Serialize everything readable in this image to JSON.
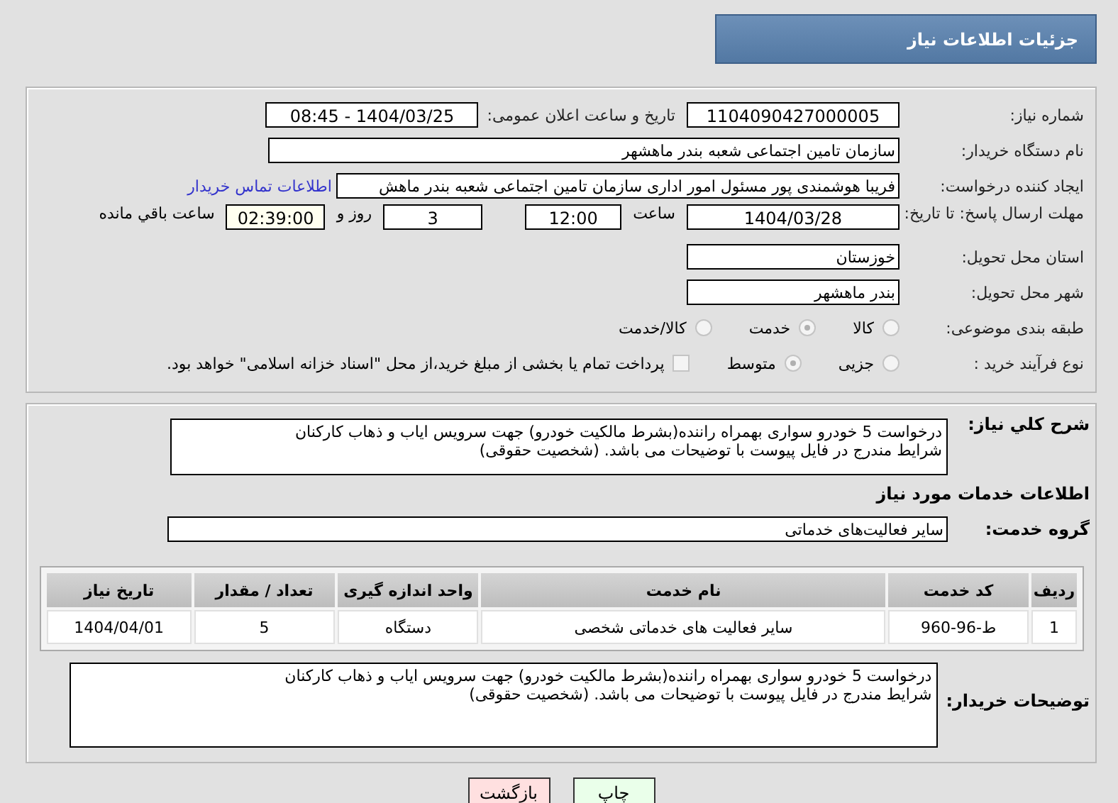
{
  "header": {
    "title": "جزئیات اطلاعات نیاز"
  },
  "need_number": {
    "label": "شماره نیاز:",
    "value": "1104090427000005"
  },
  "announce": {
    "label": "تاریخ و ساعت اعلان عمومی:",
    "value": "1404/03/25 - 08:45"
  },
  "buyer_org": {
    "label": "نام دستگاه خریدار:",
    "value": "سازمان تامین اجتماعی شعبه بندر ماهشهر"
  },
  "creator": {
    "label": "ایجاد کننده درخواست:",
    "value": "فریبا هوشمندی پور مسئول امور اداری سازمان تامین اجتماعی شعبه بندر ماهش",
    "link": "اطلاعات تماس خریدار"
  },
  "deadline": {
    "label": "مهلت ارسال پاسخ: تا تاریخ:",
    "date": "1404/03/28",
    "time_label": "ساعت",
    "time": "12:00",
    "days": "3",
    "days_label": "روز و",
    "remaining": "02:39:00",
    "remaining_label": "ساعت باقي مانده"
  },
  "province": {
    "label": "استان محل تحویل:",
    "value": "خوزستان"
  },
  "city": {
    "label": "شهر محل تحویل:",
    "value": "بندر ماهشهر"
  },
  "category": {
    "label": "طبقه بندی موضوعی:",
    "options": [
      {
        "label": "کالا",
        "selected": false
      },
      {
        "label": "خدمت",
        "selected": true
      },
      {
        "label": "کالا/خدمت",
        "selected": false
      }
    ]
  },
  "purchase_type": {
    "label": "نوع فرآیند خرید :",
    "options": [
      {
        "label": "جزیی",
        "selected": false
      },
      {
        "label": "متوسط",
        "selected": true
      }
    ],
    "treasury": {
      "checked": false,
      "label": "پرداخت تمام یا بخشی از مبلغ خرید،از محل \"اسناد خزانه اسلامی\" خواهد بود."
    }
  },
  "description": {
    "label": "شرح کلي نیاز:",
    "value": "درخواست 5 خودرو سواری بهمراه راننده(بشرط مالکیت خودرو) جهت سرویس ایاب و ذهاب کارکنان\nشرایط مندرج در فایل پیوست با توضیحات می باشد. (شخصیت حقوقی)"
  },
  "services_title": "اطلاعات خدمات مورد نیاز",
  "service_group": {
    "label": "گروه خدمت:",
    "value": "سایر فعالیت‌های خدماتی"
  },
  "table": {
    "columns": [
      "ردیف",
      "کد خدمت",
      "نام خدمت",
      "واحد اندازه گیری",
      "تعداد / مقدار",
      "تاریخ نیاز"
    ],
    "rows": [
      [
        "1",
        "ط-96-960",
        "سایر فعالیت های خدماتی شخصی",
        "دستگاه",
        "5",
        "1404/04/01"
      ]
    ]
  },
  "buyer_notes": {
    "label": "توضیحات خریدار:",
    "value": "درخواست 5 خودرو سواری بهمراه راننده(بشرط مالکیت خودرو) جهت سرویس ایاب و ذهاب کارکنان\nشرایط مندرج در فایل پیوست با توضیحات می باشد. (شخصیت حقوقی)"
  },
  "buttons": [
    {
      "label": "چاپ",
      "kind": "print"
    },
    {
      "label": "بازگشت",
      "kind": "back"
    }
  ]
}
